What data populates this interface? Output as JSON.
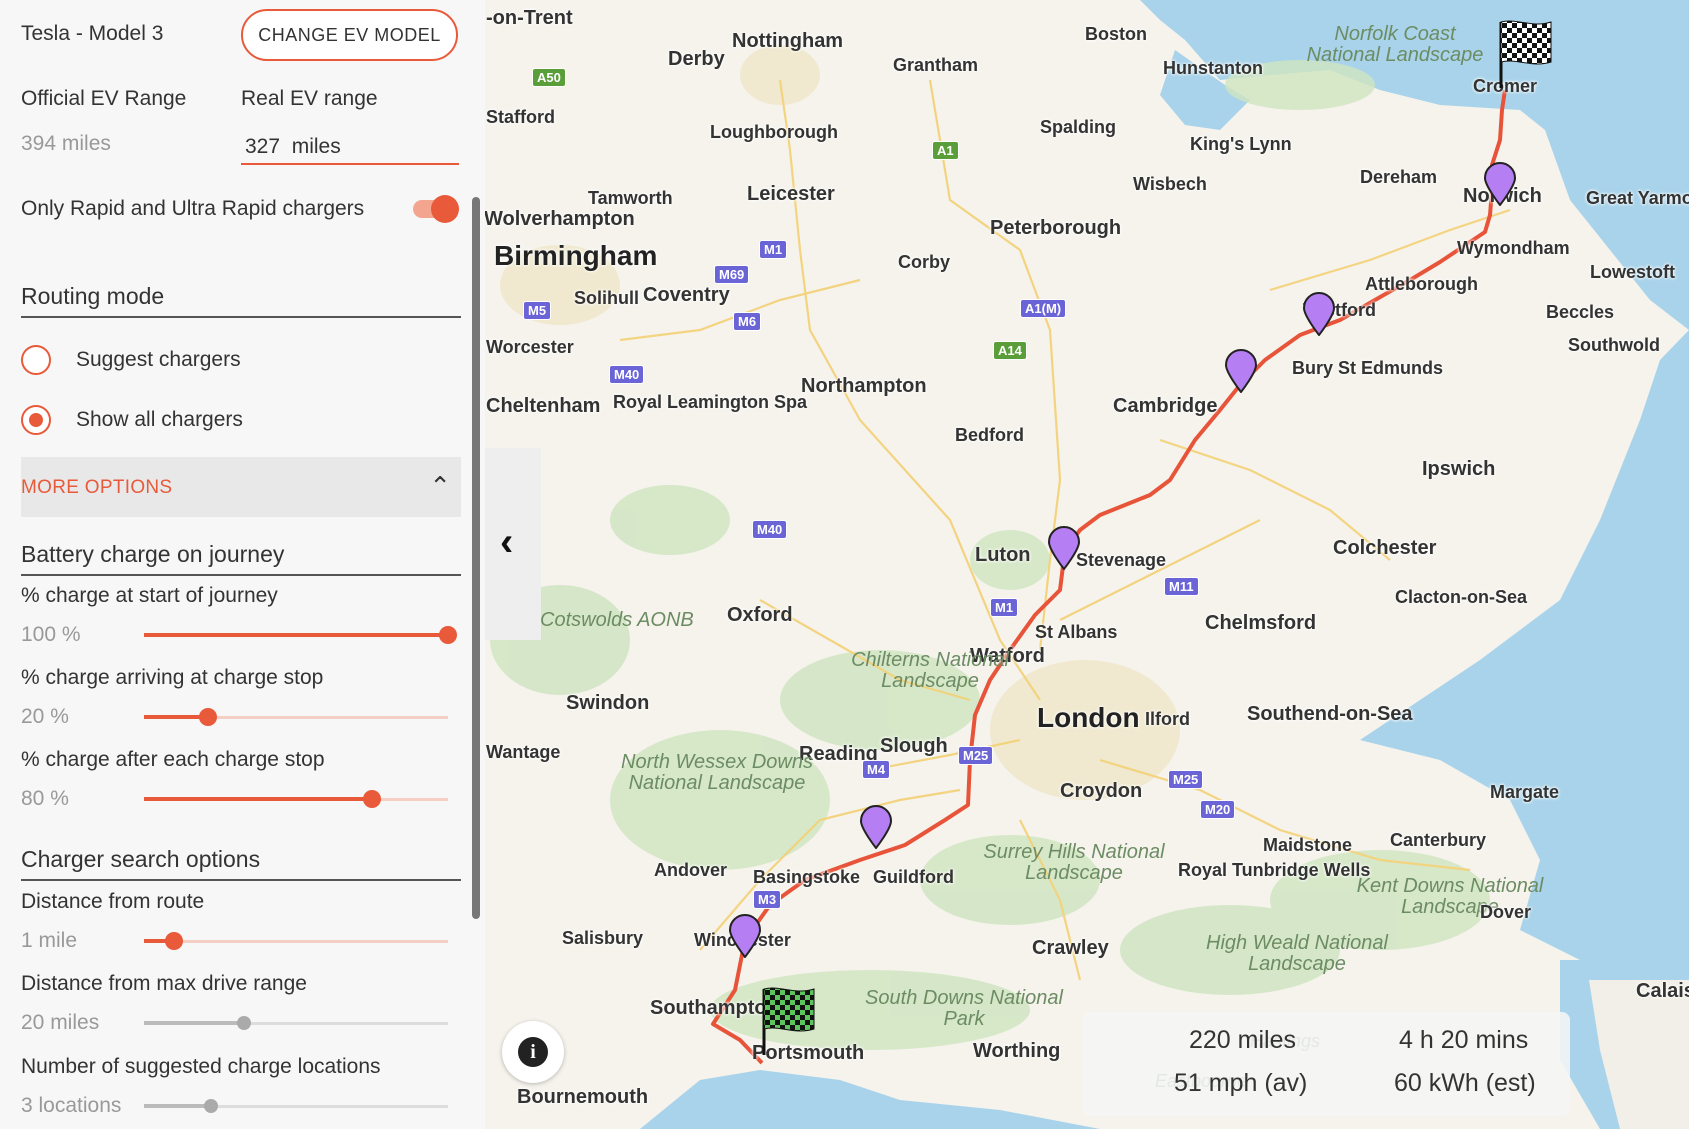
{
  "panel": {
    "ev_model": "Tesla - Model 3",
    "change_button": "CHANGE EV MODEL",
    "official_range_label": "Official EV Range",
    "official_range_value": "394 miles",
    "real_range_label": "Real EV range",
    "real_range_value": "327  miles",
    "rapid_only_label": "Only Rapid and Ultra Rapid chargers",
    "rapid_only_on": true,
    "routing_mode_heading": "Routing mode",
    "routing_options": [
      {
        "label": "Suggest chargers",
        "selected": false
      },
      {
        "label": "Show all chargers",
        "selected": true
      }
    ],
    "more_options": "MORE OPTIONS",
    "battery_heading": "Battery charge on journey",
    "battery_sliders": [
      {
        "label": "% charge at start of journey",
        "value_text": "100 %",
        "fraction": 1.0
      },
      {
        "label": "% charge arriving at charge stop",
        "value_text": "20 %",
        "fraction": 0.21
      },
      {
        "label": "% charge after each charge stop",
        "value_text": "80 %",
        "fraction": 0.75
      }
    ],
    "charger_heading": "Charger search options",
    "charger_sliders": [
      {
        "label": "Distance from route",
        "value_text": "1 mile",
        "fraction": 0.1
      },
      {
        "label": "Distance from max drive range",
        "value_text": "20 miles",
        "fraction": 0.33
      },
      {
        "label": "Number of suggested charge locations",
        "value_text": "3 locations",
        "fraction": 0.22
      }
    ]
  },
  "map": {
    "collapse_icon": "chevron-left-icon",
    "info_icon": "info-icon",
    "route_color": "#e8543a",
    "marker_color": "#b57ef2",
    "places": [
      "Nottingham",
      "Derby",
      "Grantham",
      "Boston",
      "Hunstanton",
      "Norfolk Coast National Landscape",
      "Cromer",
      "Loughborough",
      "Spalding",
      "King's Lynn",
      "Leicester",
      "Tamworth",
      "Birmingham",
      "Solihull",
      "Coventry",
      "Corby",
      "Peterborough",
      "Wisbech",
      "Dereham",
      "Norwich",
      "Great Yarmouth",
      "Wymondham",
      "Attleborough",
      "Lowestoft",
      "Beccles",
      "Southwold",
      "Thetford",
      "Bury St Edmunds",
      "Cambridge",
      "Northampton",
      "Royal Leamington Spa",
      "Bedford",
      "Ipswich",
      "Colchester",
      "Clacton-on-Sea",
      "Luton",
      "Stevenage",
      "Chelmsford",
      "St Albans",
      "Watford",
      "Oxford",
      "Chilterns National Landscape",
      "Swindon",
      "London",
      "Ilford",
      "Southend-on-Sea",
      "Slough",
      "Reading",
      "North Wessex Downs National Landscape",
      "Croydon",
      "Margate",
      "Maidstone",
      "Canterbury",
      "Andover",
      "Basingstoke",
      "Guildford",
      "Surrey Hills National Landscape",
      "Royal Tunbridge Wells",
      "Kent Downs National Landscape",
      "Dover",
      "Salisbury",
      "Winchester",
      "Crawley",
      "High Weald National Landscape",
      "Southampton",
      "South Downs National Park",
      "Portsmouth",
      "Worthing",
      "Bournemouth",
      "Calais",
      "Eastbourne",
      "Hastings",
      "-on-Trent",
      "Stafford",
      "Wolverhampton",
      "Worcester",
      "Cheltenham",
      "Cotswolds AONB",
      "Birmingham"
    ],
    "roads": [
      "A50",
      "M1",
      "A1",
      "M69",
      "M5",
      "M6",
      "M40",
      "A1(M)",
      "A14",
      "M11",
      "M1",
      "M25",
      "M4",
      "M25",
      "M20",
      "M3"
    ],
    "stats": {
      "distance": "220 miles",
      "duration": "4 h 20 mins",
      "avg_speed": "51 mph (av)",
      "energy": "60 kWh (est)"
    }
  }
}
